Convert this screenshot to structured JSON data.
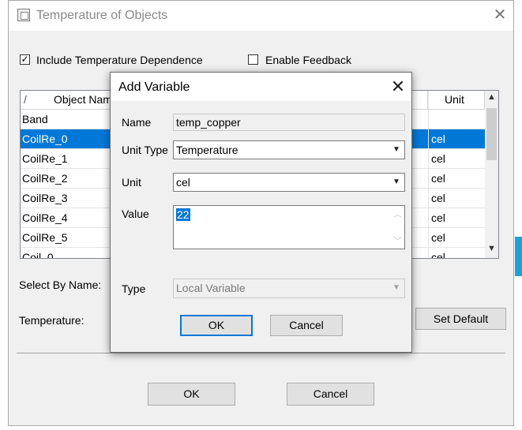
{
  "outer": {
    "title": "Temperature of Objects",
    "include_temp_label": "Include Temperature Dependence",
    "include_temp_checked": true,
    "enable_feedback_label": "Enable Feedback",
    "enable_feedback_checked": false,
    "table": {
      "columns": [
        "Object Name",
        "Unit"
      ],
      "rows": [
        {
          "name": "Band",
          "unit": "",
          "selected": false
        },
        {
          "name": "CoilRe_0",
          "unit": "cel",
          "selected": true
        },
        {
          "name": "CoilRe_1",
          "unit": "cel",
          "selected": false
        },
        {
          "name": "CoilRe_2",
          "unit": "cel",
          "selected": false
        },
        {
          "name": "CoilRe_3",
          "unit": "cel",
          "selected": false
        },
        {
          "name": "CoilRe_4",
          "unit": "cel",
          "selected": false
        },
        {
          "name": "CoilRe_5",
          "unit": "cel",
          "selected": false
        },
        {
          "name": "Coil_0",
          "unit": "cel",
          "selected": false
        }
      ]
    },
    "select_by_name_label": "Select By Name:",
    "temperature_label": "Temperature:",
    "set_default_label": "Set Default",
    "ok_label": "OK",
    "cancel_label": "Cancel"
  },
  "dialog": {
    "title": "Add Variable",
    "name_label": "Name",
    "name_value": "temp_copper",
    "unit_type_label": "Unit Type",
    "unit_type_value": "Temperature",
    "unit_label": "Unit",
    "unit_value": "cel",
    "value_label": "Value",
    "value_value": "22",
    "type_label": "Type",
    "type_value": "Local Variable",
    "ok_label": "OK",
    "cancel_label": "Cancel"
  },
  "colors": {
    "selection": "#0078d7",
    "window_bg": "#f0f0f0"
  }
}
